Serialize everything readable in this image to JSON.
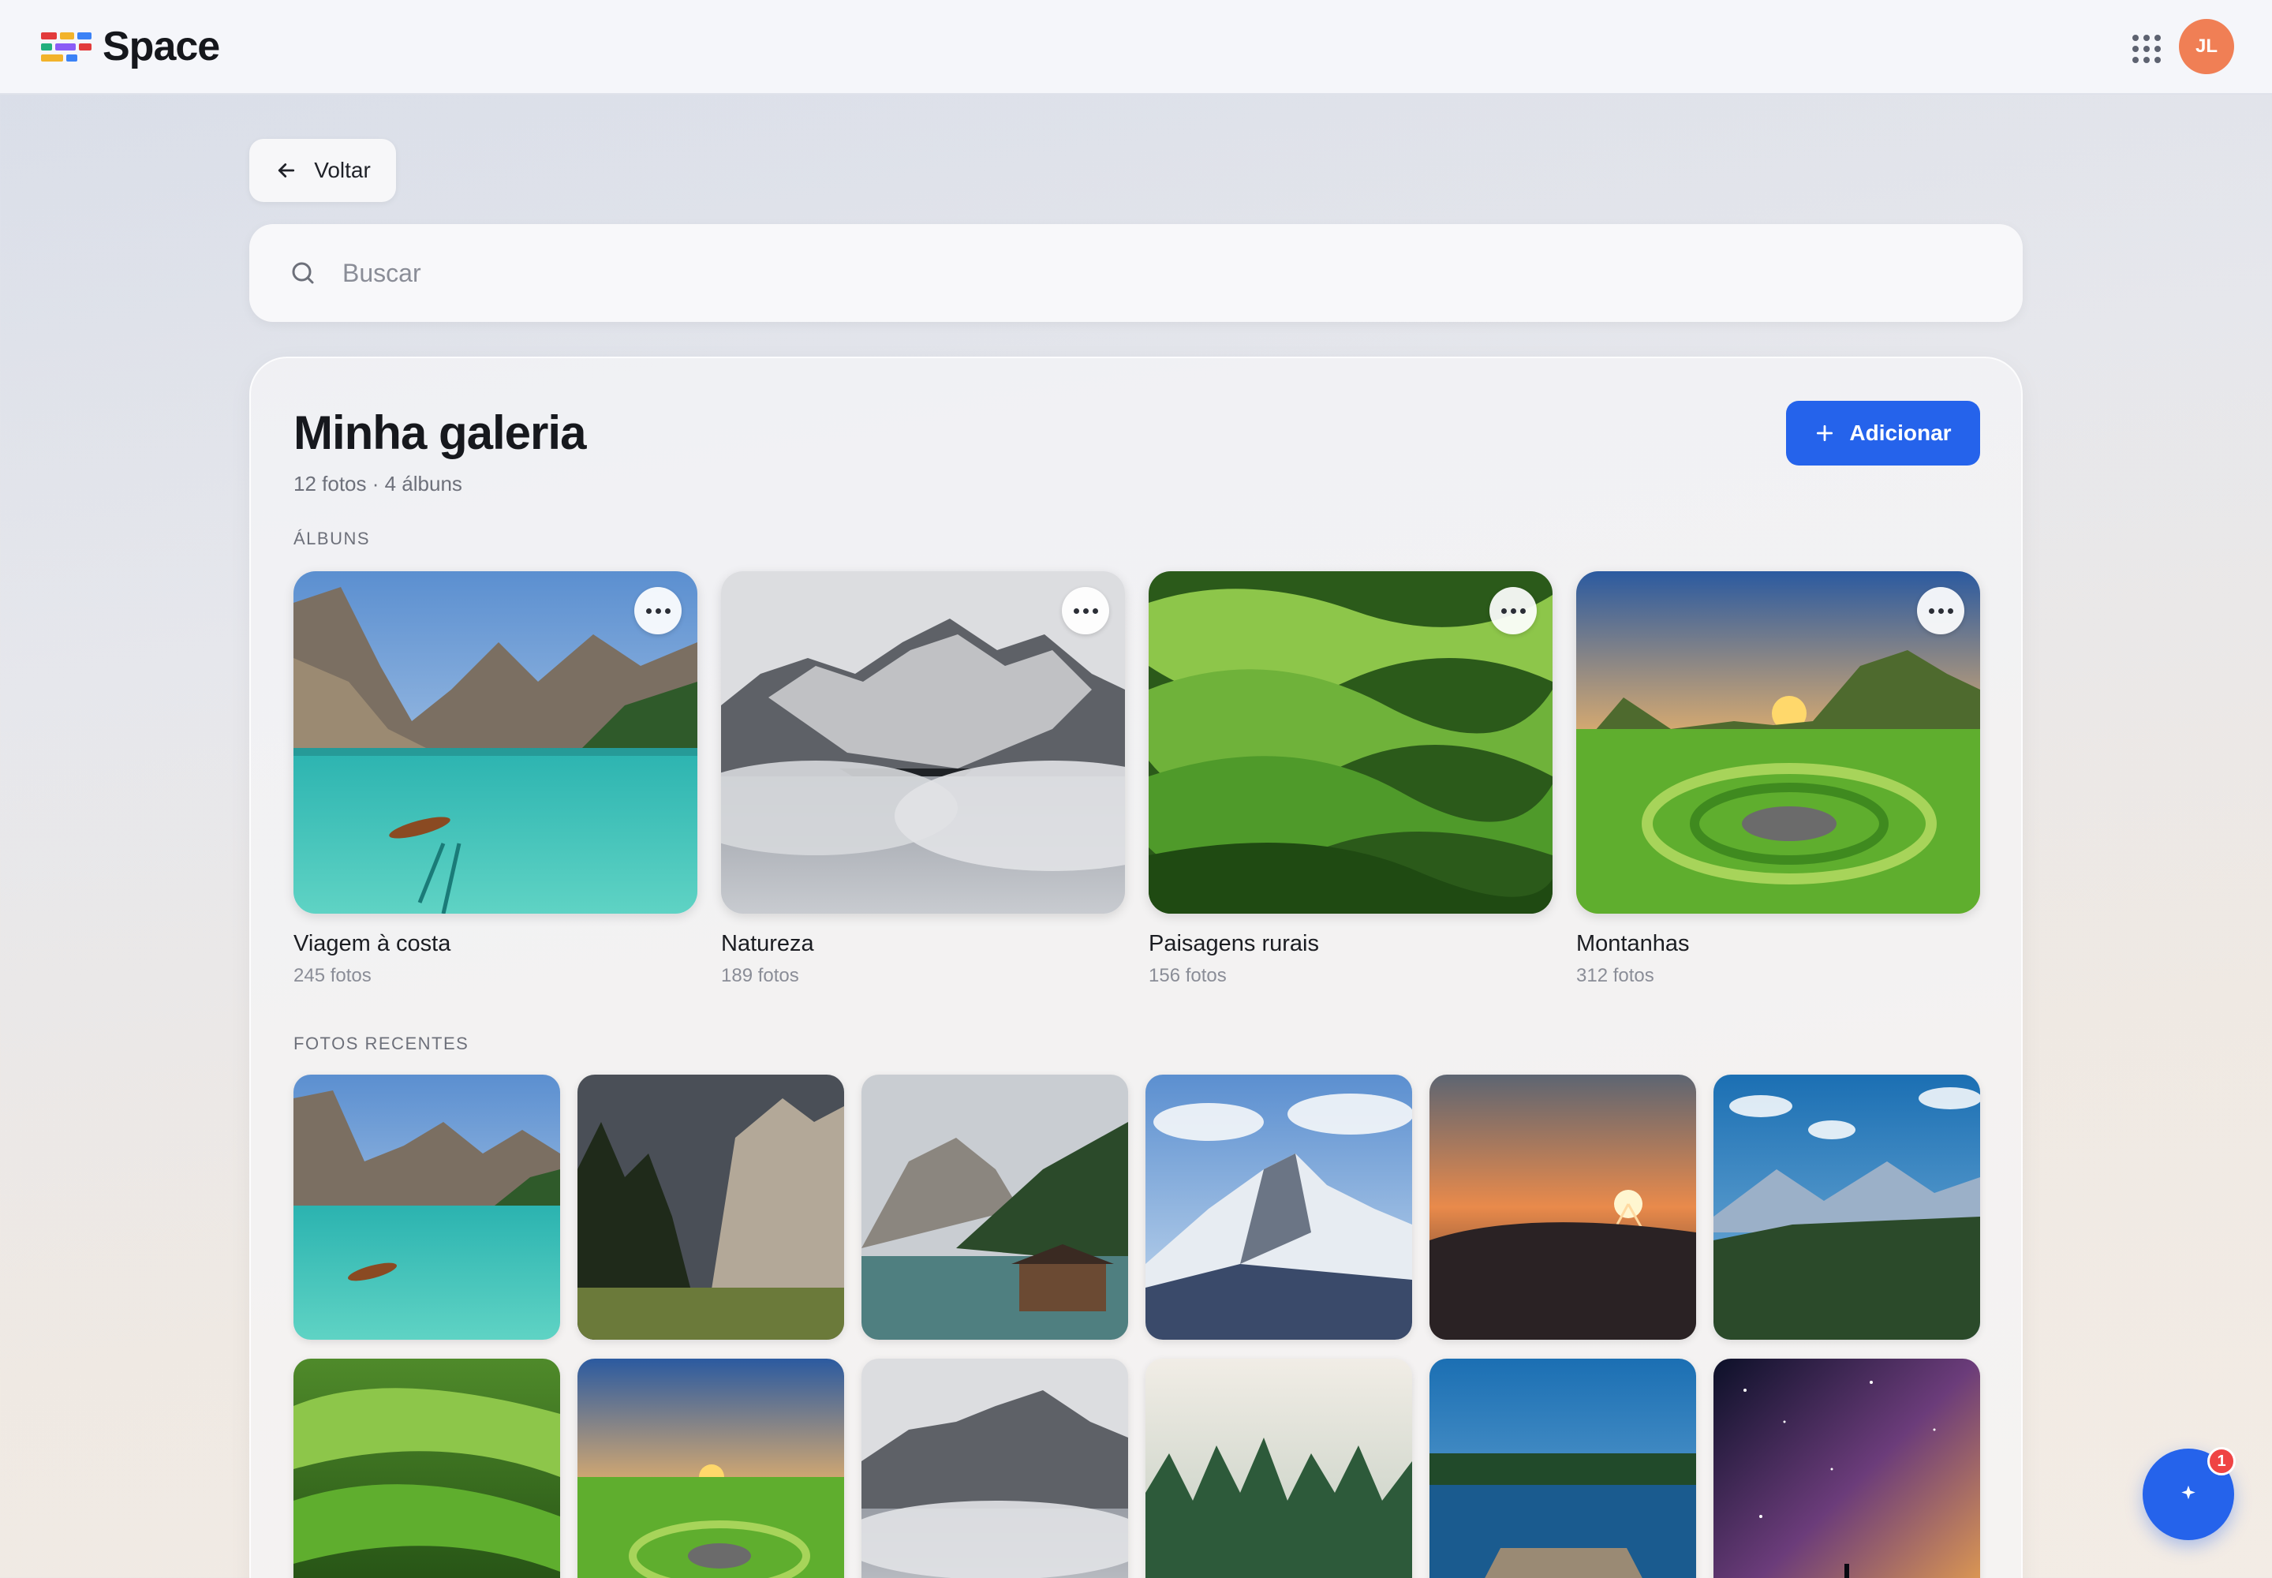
{
  "header": {
    "brand": "Space",
    "avatar_initials": "JL",
    "avatar_color": "#f07f55"
  },
  "back": {
    "label": "Voltar"
  },
  "search": {
    "placeholder": "Buscar"
  },
  "gallery": {
    "title": "Minha galeria",
    "subtitle": "12 fotos · 4 álbuns",
    "add_label": "Adicionar",
    "accent_color": "#2563eb",
    "albums_label": "ÁLBUNS",
    "recent_label": "FOTOS RECENTES",
    "albums": [
      {
        "name": "Viagem à costa",
        "count": "245 fotos"
      },
      {
        "name": "Natureza",
        "count": "189 fotos"
      },
      {
        "name": "Paisagens rurais",
        "count": "156 fotos"
      },
      {
        "name": "Montanhas",
        "count": "312 fotos"
      }
    ]
  },
  "fab": {
    "badge": "1"
  }
}
